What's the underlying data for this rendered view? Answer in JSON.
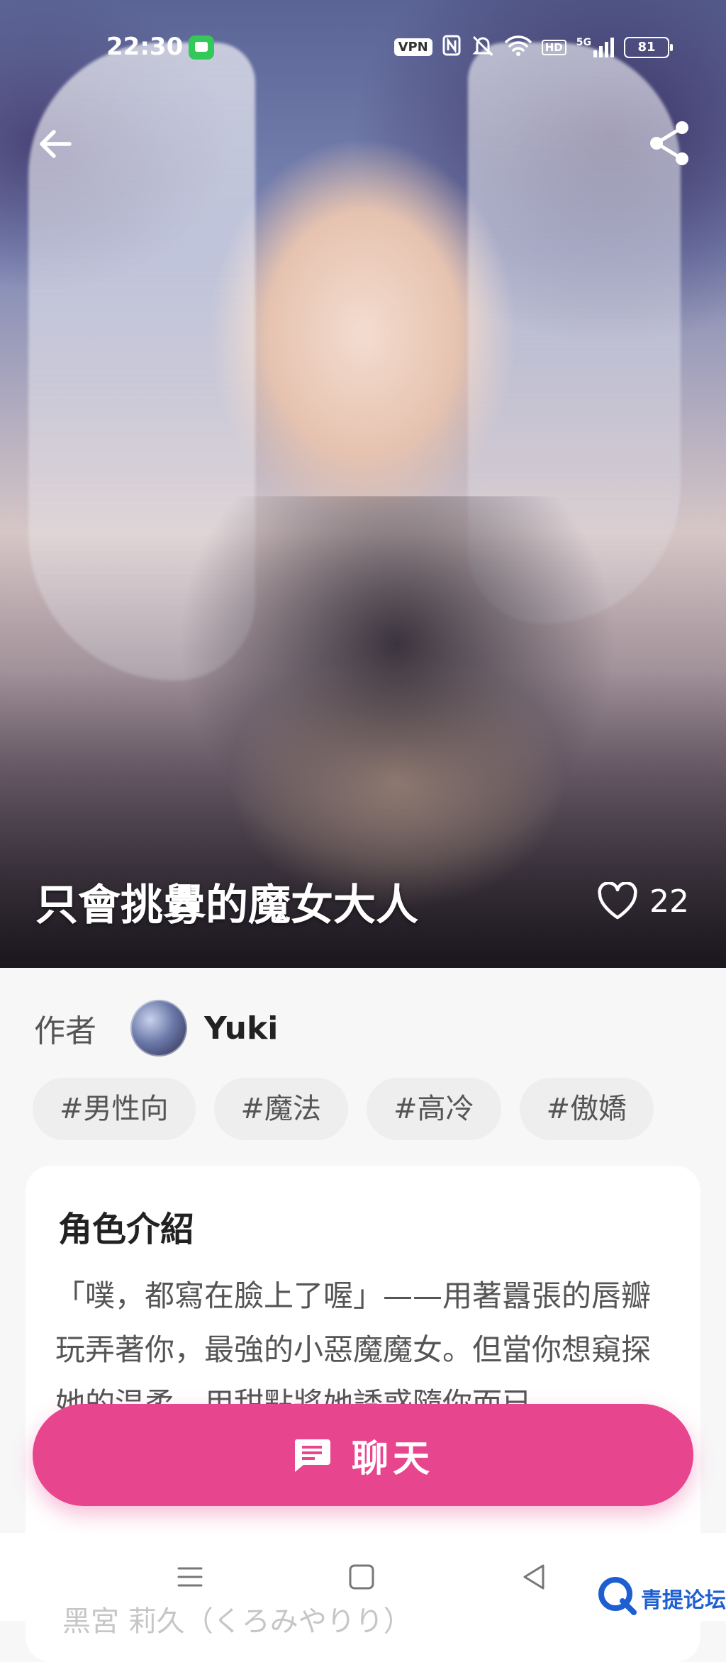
{
  "status_bar": {
    "time": "22:30",
    "vpn": "VPN",
    "network": "5G",
    "hd": "HD",
    "battery": "81"
  },
  "nav": {
    "back_icon": "arrow-left-icon",
    "share_icon": "share-icon"
  },
  "character": {
    "title": "只會挑釁的魔女大人",
    "like_count": "22"
  },
  "author": {
    "label": "作者",
    "name": "Yuki"
  },
  "tags": [
    "#男性向",
    "#魔法",
    "#高冷",
    "#傲嬌"
  ],
  "intro": {
    "heading": "角色介紹",
    "text": "「噗，都寫在臉上了喔」——用著囂張的唇瓣玩弄著你，最強的小惡魔魔女。但當你想窺探她的温柔，用甜點將她誘惑隨你而已。"
  },
  "chat_button": {
    "label": "聊天"
  },
  "behind_text": "黑宮 莉久（くろみやりり）",
  "watermark": "青提论坛",
  "colors": {
    "accent": "#e8458f",
    "tag_bg": "#eeeeef",
    "page_bg": "#f7f7f8"
  }
}
